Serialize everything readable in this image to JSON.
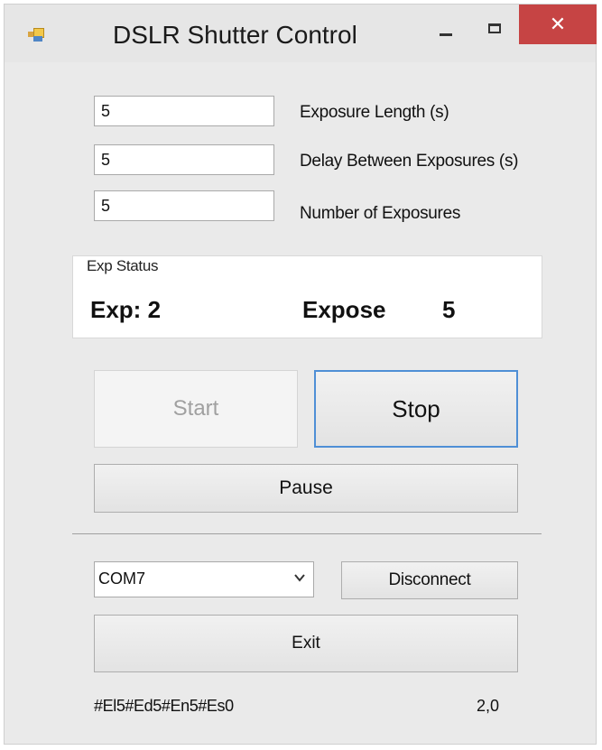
{
  "window": {
    "title": "DSLR Shutter Control",
    "close_glyph": "✕"
  },
  "fields": [
    {
      "value": "5",
      "label": "Exposure Length (s)"
    },
    {
      "value": "5",
      "label": "Delay Between Exposures (s)"
    },
    {
      "value": "5",
      "label": "Number of Exposures"
    }
  ],
  "exp_status": {
    "title": "Exp Status",
    "exp_text": "Exp: 2",
    "state_text": "Expose",
    "countdown": "5"
  },
  "buttons": {
    "start": "Start",
    "stop": "Stop",
    "pause": "Pause",
    "disconnect": "Disconnect",
    "exit": "Exit"
  },
  "port": {
    "selected": "COM7"
  },
  "status_bar": {
    "left": "#El5#Ed5#En5#Es0",
    "right": "2,0"
  },
  "colors": {
    "close_button": "#c64444",
    "focus_border": "#4f8fd6",
    "window_bg": "#eaeaea"
  },
  "icons": [
    "app-icon",
    "minimize-icon",
    "maximize-icon",
    "close-icon",
    "chevron-down-icon"
  ]
}
